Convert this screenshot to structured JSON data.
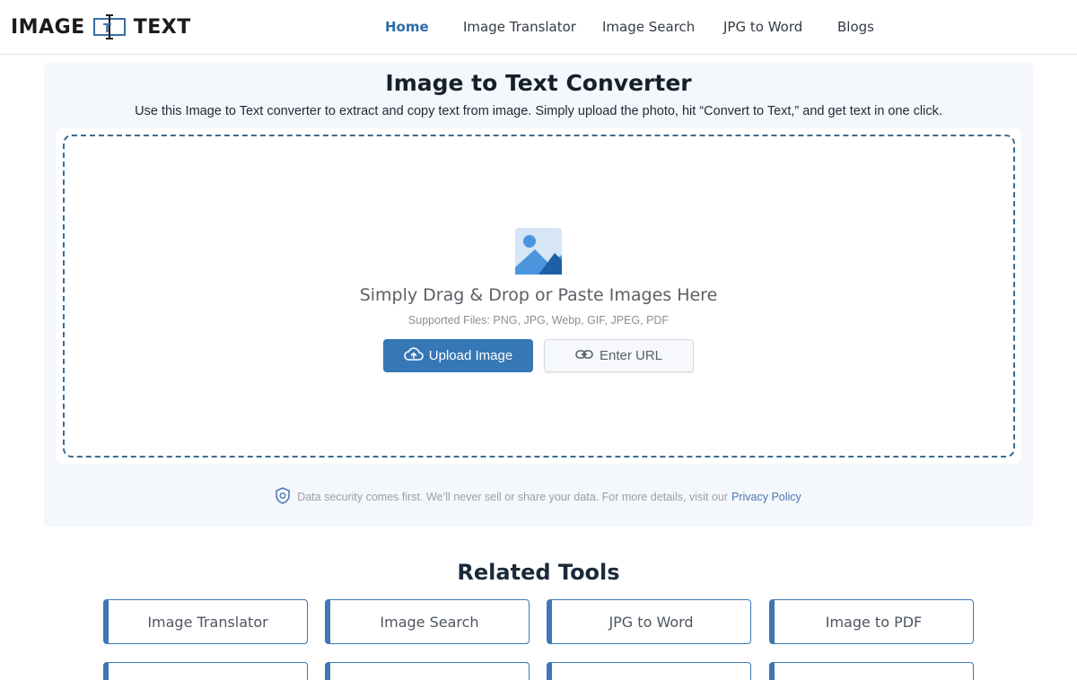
{
  "header": {
    "logo_left": "IMAGE",
    "logo_mark": "T",
    "logo_right": "TEXT",
    "nav": [
      {
        "label": "Home",
        "active": true
      },
      {
        "label": "Image Translator",
        "active": false
      },
      {
        "label": "Image Search",
        "active": false
      },
      {
        "label": "JPG to Word",
        "active": false
      },
      {
        "label": "Blogs",
        "active": false
      }
    ]
  },
  "converter": {
    "title": "Image to Text Converter",
    "subtitle": "Use this Image to Text converter to extract and copy text from image. Simply upload the photo, hit “Convert to Text,” and get text in one click.",
    "drop_title": "Simply Drag & Drop or Paste Images Here",
    "supported_files": "Supported Files: PNG, JPG, Webp, GIF, JPEG, PDF",
    "upload_label": "Upload Image",
    "url_label": "Enter URL",
    "security_text": "Data security comes first. We’ll never sell or share your data. For more details, visit our",
    "privacy_link": "Privacy Policy"
  },
  "related": {
    "title": "Related Tools",
    "tools": [
      "Image Translator",
      "Image Search",
      "JPG to Word",
      "Image to PDF"
    ]
  },
  "icons": {
    "upload": "cloud-upload-icon",
    "url": "link-icon",
    "image": "image-placeholder-icon",
    "security": "shield-icon"
  },
  "colors": {
    "accent": "#3677b5",
    "active_nav": "#2e6ca4",
    "panel_bg": "#f4f7fc",
    "dashed_border": "#3a6c93"
  }
}
